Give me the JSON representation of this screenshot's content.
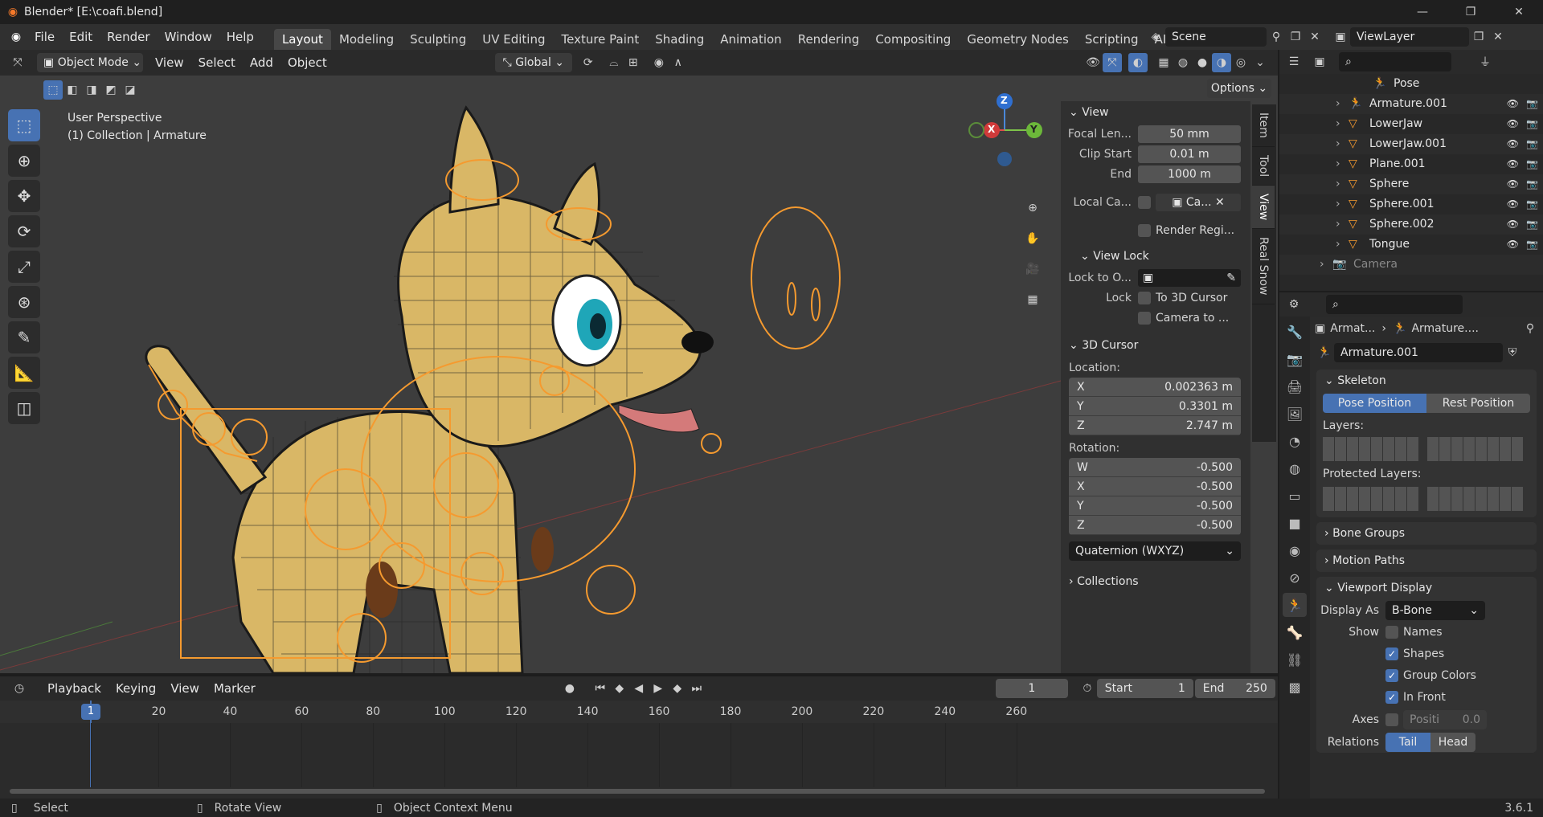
{
  "title": "Blender* [E:\\coafi.blend]",
  "menu": [
    "File",
    "Edit",
    "Render",
    "Window",
    "Help"
  ],
  "workspaces": [
    "Layout",
    "Modeling",
    "Sculpting",
    "UV Editing",
    "Texture Paint",
    "Shading",
    "Animation",
    "Rendering",
    "Compositing",
    "Geometry Nodes",
    "Scripting",
    "AI Render"
  ],
  "scene": "Scene",
  "view_layer": "ViewLayer",
  "viewport_header": {
    "mode": "Object Mode",
    "items": [
      "View",
      "Select",
      "Add",
      "Object"
    ],
    "orientation": "Global",
    "options": "Options"
  },
  "viewport_overlay": {
    "line1": "User Perspective",
    "line2": "(1) Collection | Armature"
  },
  "gizmo": {
    "z": "Z",
    "x": "X",
    "y": "Y"
  },
  "npanel": {
    "view_title": "View",
    "focal_label": "Focal Len...",
    "focal": "50 mm",
    "clip_start_label": "Clip Start",
    "clip_start": "0.01 m",
    "end_label": "End",
    "clip_end": "1000 m",
    "local_cam_label": "Local Ca...",
    "local_cam_value": "Ca...",
    "render_region": "Render Regi...",
    "view_lock_title": "View Lock",
    "lock_to_label": "Lock to O...",
    "lock_label": "Lock",
    "to_3d_cursor": "To 3D Cursor",
    "camera_to": "Camera to ...",
    "cursor_title": "3D Cursor",
    "location_label": "Location:",
    "loc": [
      {
        "axis": "X",
        "val": "0.002363 m"
      },
      {
        "axis": "Y",
        "val": "0.3301 m"
      },
      {
        "axis": "Z",
        "val": "2.747 m"
      }
    ],
    "rotation_label": "Rotation:",
    "rot": [
      {
        "axis": "W",
        "val": "-0.500"
      },
      {
        "axis": "X",
        "val": "-0.500"
      },
      {
        "axis": "Y",
        "val": "-0.500"
      },
      {
        "axis": "Z",
        "val": "-0.500"
      }
    ],
    "rot_mode": "Quaternion (WXYZ)",
    "collections_title": "Collections"
  },
  "side_tabs": [
    "Item",
    "Tool",
    "View",
    "Real Snow"
  ],
  "timeline": {
    "menus": [
      "Playback",
      "Keying",
      "View",
      "Marker"
    ],
    "current_frame": "1",
    "start_label": "Start",
    "start": "1",
    "end_label": "End",
    "end": "250",
    "ticks": [
      "1",
      "20",
      "40",
      "60",
      "80",
      "100",
      "120",
      "140",
      "160",
      "180",
      "200",
      "220",
      "240",
      "260"
    ]
  },
  "status": {
    "select": "Select",
    "rotate": "Rotate View",
    "context": "Object Context Menu",
    "version": "3.6.1"
  },
  "outliner": [
    {
      "name": "Pose",
      "icon": "pose-icon",
      "indent": 1
    },
    {
      "name": "Armature.001",
      "icon": "armature-icon",
      "indent": 0
    },
    {
      "name": "LowerJaw",
      "icon": "mesh-icon",
      "indent": 0
    },
    {
      "name": "LowerJaw.001",
      "icon": "mesh-icon",
      "indent": 0
    },
    {
      "name": "Plane.001",
      "icon": "mesh-icon",
      "indent": 0
    },
    {
      "name": "Sphere",
      "icon": "mesh-icon",
      "indent": 0
    },
    {
      "name": "Sphere.001",
      "icon": "mesh-icon",
      "indent": 0
    },
    {
      "name": "Sphere.002",
      "icon": "mesh-icon",
      "indent": 0
    },
    {
      "name": "Tongue",
      "icon": "mesh-icon",
      "indent": 0
    },
    {
      "name": "Camera",
      "icon": "camera-icon",
      "indent": -1
    }
  ],
  "props": {
    "breadcrumb1": "Armat...",
    "breadcrumb2": "Armature....",
    "datablock": "Armature.001",
    "skeleton_title": "Skeleton",
    "pose_position": "Pose Position",
    "rest_position": "Rest Position",
    "layers_label": "Layers:",
    "protected_label": "Protected Layers:",
    "bone_groups": "Bone Groups",
    "motion_paths": "Motion Paths",
    "viewport_display": "Viewport Display",
    "display_as_label": "Display As",
    "display_as": "B-Bone",
    "show_label": "Show",
    "names": "Names",
    "shapes": "Shapes",
    "group_colors": "Group Colors",
    "in_front": "In Front",
    "axes_label": "Axes",
    "axes_pos": "Positi",
    "axes_val": "0.0",
    "relations_label": "Relations",
    "tail": "Tail",
    "head": "Head"
  }
}
